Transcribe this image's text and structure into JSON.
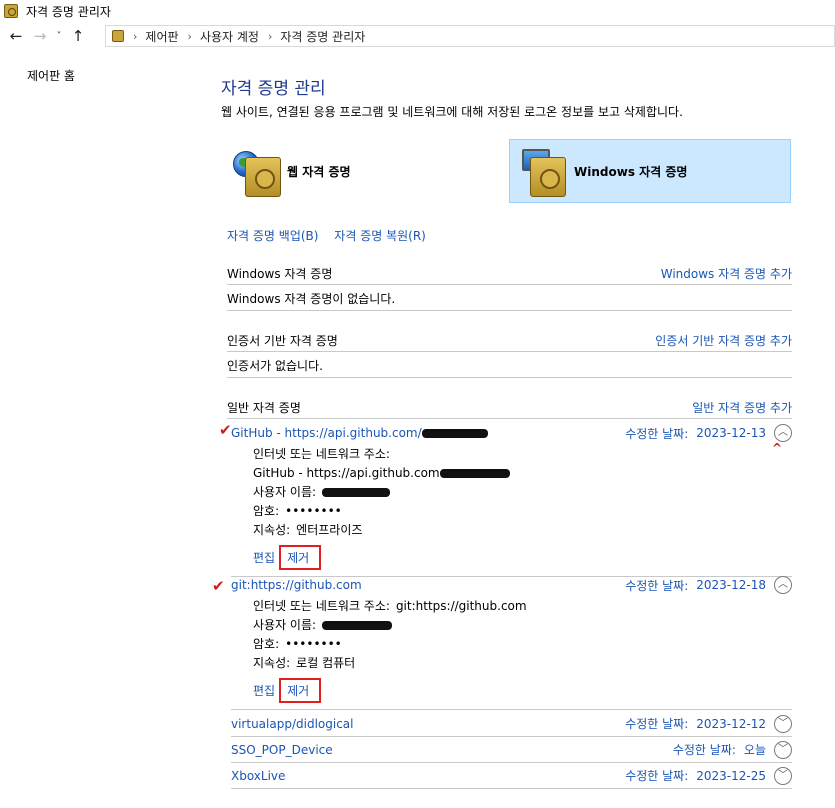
{
  "window": {
    "title": "자격 증명 관리자"
  },
  "breadcrumb": [
    "제어판",
    "사용자 계정",
    "자격 증명 관리자"
  ],
  "left_pane": {
    "home_link": "제어판 홈"
  },
  "main": {
    "title": "자격 증명 관리",
    "description": "웹 사이트, 연결된 응용 프로그램 및 네트워크에 대해 저장된 로그온 정보를 보고 삭제합니다.",
    "tiles": {
      "web": "웹 자격 증명",
      "windows": "Windows 자격 증명"
    },
    "backup_link": "자격 증명 백업(B)",
    "restore_link": "자격 증명 복원(R)"
  },
  "sections": {
    "windows": {
      "title": "Windows 자격 증명",
      "add": "Windows 자격 증명 추가",
      "empty": "Windows 자격 증명이 없습니다."
    },
    "certificate": {
      "title": "인증서 기반 자격 증명",
      "add": "인증서 기반 자격 증명 추가",
      "empty": "인증서가 없습니다."
    },
    "generic": {
      "title": "일반 자격 증명",
      "add": "일반 자격 증명 추가"
    }
  },
  "labels": {
    "modified": "수정한 날짜:",
    "address": "인터넷 또는 네트워크 주소:",
    "username": "사용자 이름:",
    "password": "암호:",
    "persistence": "지속성:",
    "edit": "편집",
    "remove": "제거"
  },
  "credentials": [
    {
      "name": "GitHub - https://api.github.com/",
      "date": "2023-12-13",
      "address": "GitHub - https://api.github.com",
      "password": "••••••••",
      "persistence": "엔터프라이즈"
    },
    {
      "name": "git:https://github.com",
      "date": "2023-12-18",
      "address": "git:https://github.com",
      "password": "••••••••",
      "persistence": "로컬 컴퓨터"
    },
    {
      "name": "virtualapp/didlogical",
      "date": "2023-12-12"
    },
    {
      "name": "SSO_POP_Device",
      "date": "오늘"
    },
    {
      "name": "XboxLive",
      "date": "2023-12-25"
    }
  ],
  "colors": {
    "link": "#1a55b5",
    "title": "#1e3a8c",
    "selected_tile": "#cce8ff",
    "annotation": "#e02020"
  }
}
